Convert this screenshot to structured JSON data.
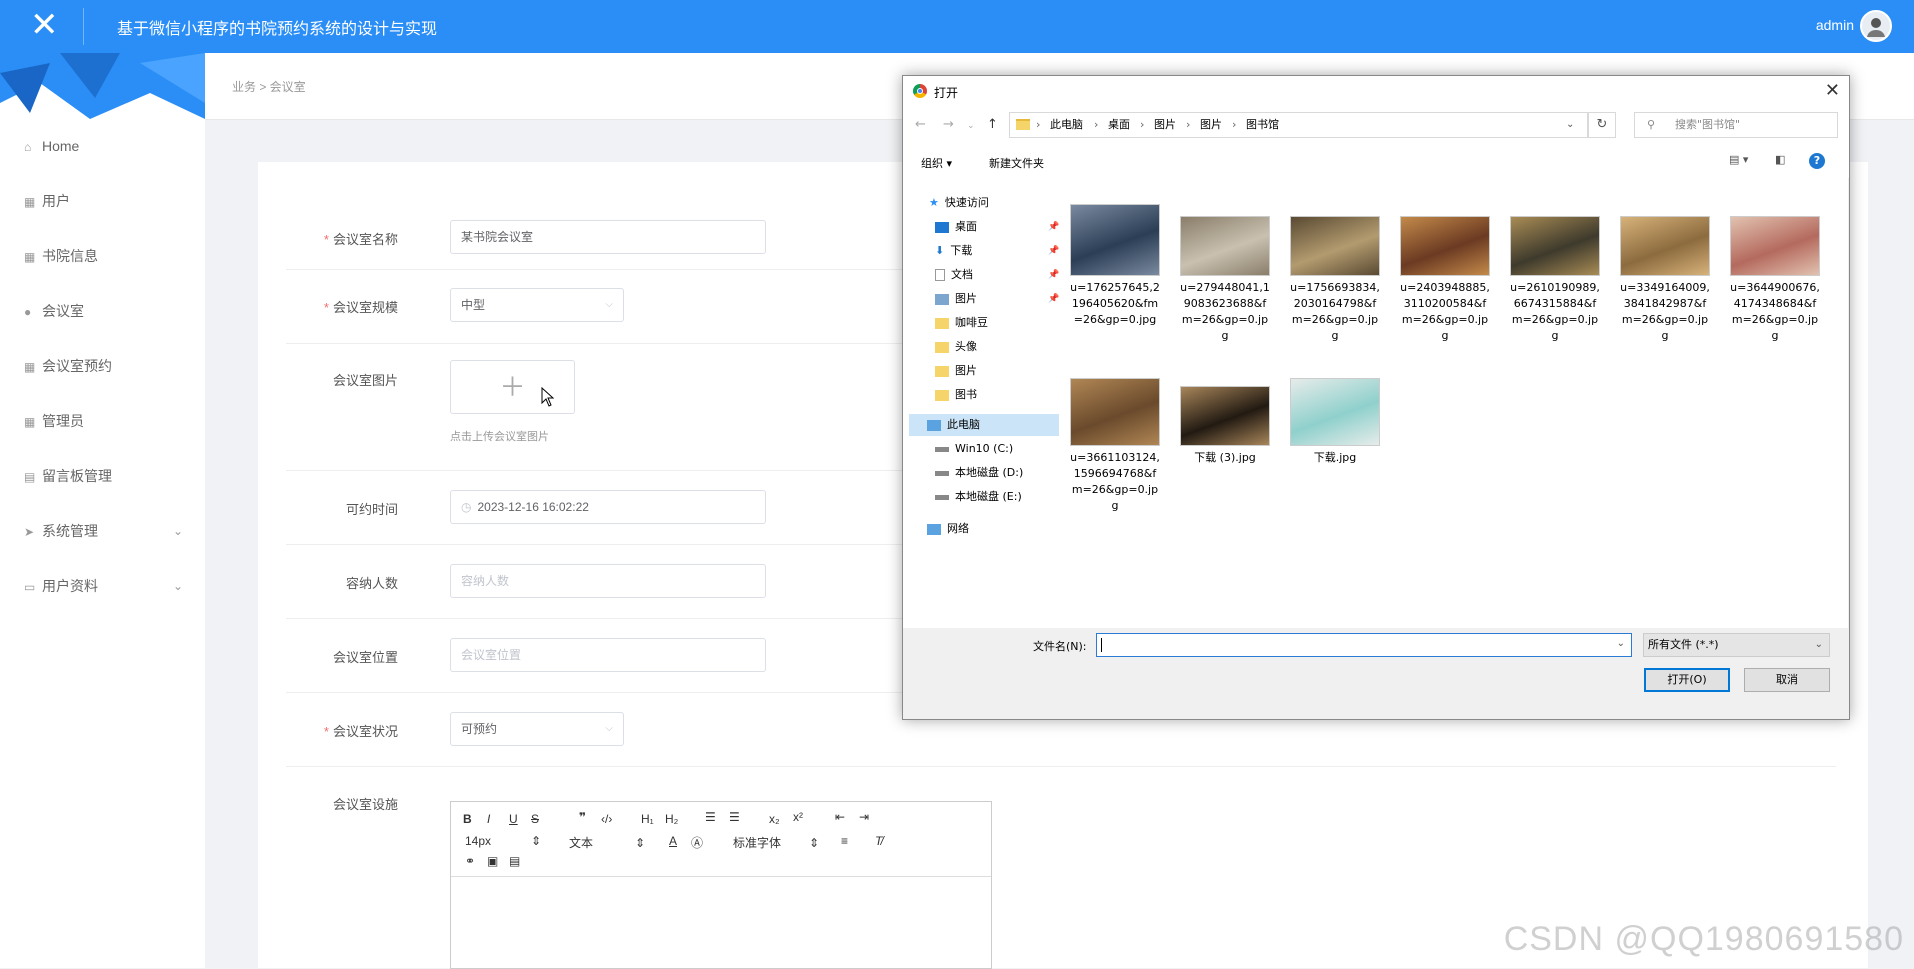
{
  "header": {
    "title": "基于微信小程序的书院预约系统的设计与实现",
    "user": "admin"
  },
  "sidebar": {
    "items": [
      {
        "label": "Home",
        "icon": "home-icon"
      },
      {
        "label": "用户",
        "icon": "grid-icon"
      },
      {
        "label": "书院信息",
        "icon": "grid-icon"
      },
      {
        "label": "会议室",
        "icon": "pin-icon"
      },
      {
        "label": "会议室预约",
        "icon": "grid-icon"
      },
      {
        "label": "管理员",
        "icon": "grid-icon"
      },
      {
        "label": "留言板管理",
        "icon": "clipboard-icon"
      },
      {
        "label": "系统管理",
        "icon": "send-icon"
      },
      {
        "label": "用户资料",
        "icon": "card-icon"
      }
    ]
  },
  "breadcrumb": "业务 > 会议室",
  "form": {
    "name_label": "会议室名称",
    "name_value": "某书院会议室",
    "scale_label": "会议室规模",
    "scale_value": "中型",
    "image_label": "会议室图片",
    "image_hint": "点击上传会议室图片",
    "time_label": "可约时间",
    "time_value": "2023-12-16 16:02:22",
    "capacity_label": "容纳人数",
    "capacity_placeholder": "容纳人数",
    "location_label": "会议室位置",
    "location_placeholder": "会议室位置",
    "status_label": "会议室状况",
    "status_value": "可预约",
    "facility_label": "会议室设施",
    "editor": {
      "font_size": "14px",
      "text_style": "文本",
      "font_family": "标准字体"
    }
  },
  "dialog": {
    "title": "打开",
    "path": [
      "此电脑",
      "桌面",
      "图片",
      "图片",
      "图书馆"
    ],
    "search_placeholder": "搜索\"图书馆\"",
    "organize": "组织 ▾",
    "new_folder": "新建文件夹",
    "nav": {
      "quick_access": "快速访问",
      "quick": [
        "桌面",
        "下载",
        "文档",
        "图片"
      ],
      "folders": [
        "咖啡豆",
        "头像",
        "图片",
        "图书"
      ],
      "this_pc": "此电脑",
      "drives": [
        "Win10 (C:)",
        "本地磁盘 (D:)",
        "本地磁盘 (E:)"
      ],
      "network": "网络"
    },
    "files": [
      {
        "name": "u=176257645,2196405620&fm=26&gp=0.jpg",
        "c1": "#2b3e55",
        "c2": "#7a8aa0"
      },
      {
        "name": "u=279448041,19083623688&fm=26&gp=0.jpg",
        "c1": "#c9c0b0",
        "c2": "#8a7e6a"
      },
      {
        "name": "u=1756693834,2030164798&fm=26&gp=0.jpg",
        "c1": "#b39b6f",
        "c2": "#5a4a33"
      },
      {
        "name": "u=2403948885,3110200584&fm=26&gp=0.jpg",
        "c1": "#6b3a22",
        "c2": "#c48a4a"
      },
      {
        "name": "u=2610190989,6674315884&fm=26&gp=0.jpg",
        "c1": "#3e3a2c",
        "c2": "#a98c55"
      },
      {
        "name": "u=3349164009,3841842987&fm=26&gp=0.jpg",
        "c1": "#8c6b3e",
        "c2": "#d7b27a"
      },
      {
        "name": "u=3644900676,4174348684&fm=26&gp=0.jpg",
        "c1": "#b46a5e",
        "c2": "#e2c2b0"
      },
      {
        "name": "u=3661103124,1596694768&fm=26&gp=0.jpg",
        "c1": "#6a4a2c",
        "c2": "#b08654"
      },
      {
        "name": "下载 (3).jpg",
        "c1": "#221a12",
        "c2": "#a8865a"
      },
      {
        "name": "下载.jpg",
        "c1": "#8fd0cc",
        "c2": "#e6ecea"
      }
    ],
    "filename_label": "文件名(N):",
    "filetype": "所有文件 (*.*)",
    "open": "打开(O)",
    "cancel": "取消"
  },
  "watermark": "CSDN @QQ1980691580",
  "colors": {
    "accent": "#2a8ef6",
    "required": "#f56c6c"
  }
}
